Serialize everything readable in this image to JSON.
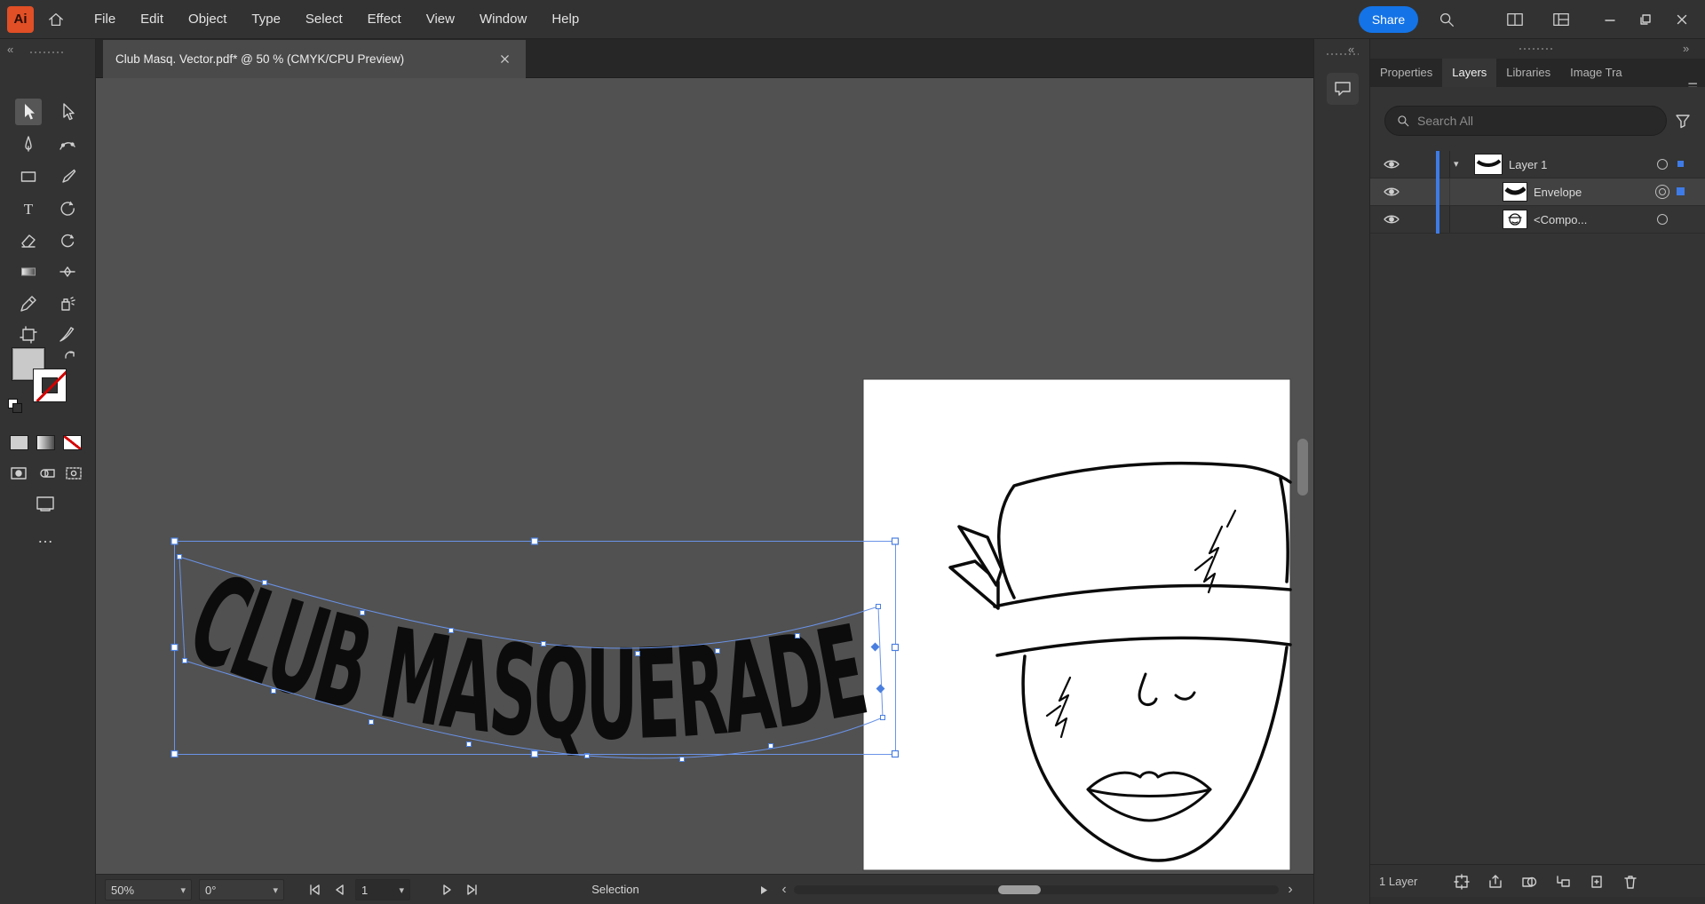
{
  "app": {
    "logo": "Ai"
  },
  "menubar": {
    "items": [
      "File",
      "Edit",
      "Object",
      "Type",
      "Select",
      "Effect",
      "View",
      "Window",
      "Help"
    ],
    "share_label": "Share"
  },
  "document_tab": {
    "title": "Club Masq. Vector.pdf* @ 50 % (CMYK/CPU Preview)"
  },
  "artwork": {
    "text": "CLUB MASQUERADE"
  },
  "status_bar": {
    "zoom": "50%",
    "rotation": "0°",
    "artboard_number": "1",
    "current_tool": "Selection"
  },
  "right_panel": {
    "tabs": [
      "Properties",
      "Layers",
      "Libraries",
      "Image Tra"
    ],
    "active_tab": "Layers",
    "search_placeholder": "Search All",
    "layers": [
      {
        "name": "Layer 1"
      },
      {
        "name": "Envelope"
      },
      {
        "name": "<Compo..."
      }
    ],
    "footer_count": "1 Layer"
  },
  "glyphs": {
    "collapse_left": "«",
    "collapse_right": "»",
    "panel_menu": "☰",
    "ellipsis": "…",
    "chevron_down": "▾",
    "row_chevron": "▾",
    "type_tool_letter": "T",
    "scroll_left": "‹",
    "scroll_right": "›"
  },
  "colors": {
    "share_blue": "#1473E6",
    "selection_blue": "#5B8BF0",
    "logo_red": "#E04F26"
  }
}
